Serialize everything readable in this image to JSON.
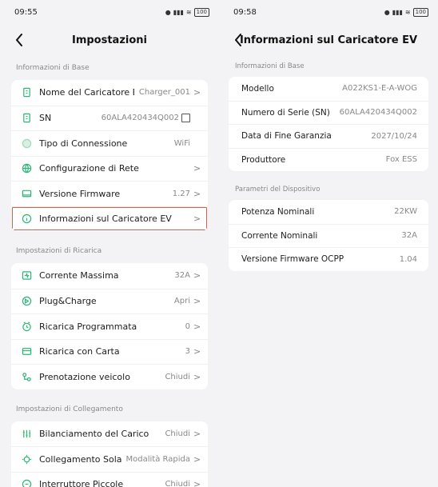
{
  "left": {
    "status": {
      "time": "09:55",
      "battery": "100"
    },
    "title": "Impostazioni",
    "sections": [
      {
        "label": "Informazioni di Base",
        "rows": [
          {
            "label": "Nome del Caricatore EV",
            "value": "Charger_001",
            "chevron": ">",
            "icon": "charger-icon"
          },
          {
            "label": "SN",
            "value": "60ALA420434Q002",
            "chevron": "",
            "icon": "charger-icon"
          },
          {
            "label": "Tipo di Connessione",
            "value": "WiFi",
            "chevron": "",
            "icon": "wifi-circle-icon"
          },
          {
            "label": "Configurazione di Rete",
            "value": "",
            "chevron": ">",
            "icon": "globe-icon"
          },
          {
            "label": "Versione Firmware",
            "value": "1.27",
            "chevron": ">",
            "icon": "monitor-icon"
          },
          {
            "label": "Informazioni sul Caricatore EV",
            "value": "",
            "chevron": ">",
            "icon": "info-icon"
          }
        ]
      },
      {
        "label": "Impostazioni di Ricarica",
        "rows": [
          {
            "label": "Corrente Massima",
            "value": "32A",
            "chevron": ">",
            "icon": "current-icon"
          },
          {
            "label": "Plug&Charge",
            "value": "Apri",
            "chevron": ">",
            "icon": "plug-icon"
          },
          {
            "label": "Ricarica Programmata",
            "value": "0",
            "chevron": ">",
            "icon": "clock-icon"
          },
          {
            "label": "Ricarica con Carta",
            "value": "3",
            "chevron": ">",
            "icon": "card-icon"
          },
          {
            "label": "Prenotazione veicolo",
            "value": "Chiudi",
            "chevron": ">",
            "icon": "car-icon"
          }
        ]
      },
      {
        "label": "Impostazioni di Collegamento",
        "rows": [
          {
            "label": "Bilanciamento del Carico",
            "value": "Chiudi",
            "chevron": ">",
            "icon": "balance-icon"
          },
          {
            "label": "Collegamento Solare",
            "value": "Modalità Rapida",
            "chevron": ">",
            "icon": "sun-icon"
          },
          {
            "label": "Interruttore Piccole",
            "value": "Chiudi",
            "chevron": ">",
            "icon": "switch-icon"
          }
        ]
      }
    ]
  },
  "right": {
    "status": {
      "time": "09:58",
      "battery": "100"
    },
    "title": "Informazioni sul Caricatore EV",
    "sections": [
      {
        "label": "Informazioni di Base",
        "rows": [
          {
            "label": "Modello",
            "value": "A022KS1-E-A-WOG"
          },
          {
            "label": "Numero di Serie (SN)",
            "value": "60ALA420434Q002"
          },
          {
            "label": "Data di Fine Garanzia",
            "value": "2027/10/24"
          },
          {
            "label": "Produttore",
            "value": "Fox ESS"
          }
        ]
      },
      {
        "label": "Parametri del Dispositivo",
        "rows": [
          {
            "label": "Potenza Nominali",
            "value": "22KW"
          },
          {
            "label": "Corrente Nominali",
            "value": "32A"
          },
          {
            "label": "Versione Firmware OCPP",
            "value": "1.04"
          }
        ]
      }
    ]
  },
  "colors": {
    "accent": "#2bb673",
    "highlight": "#e05a4a"
  }
}
